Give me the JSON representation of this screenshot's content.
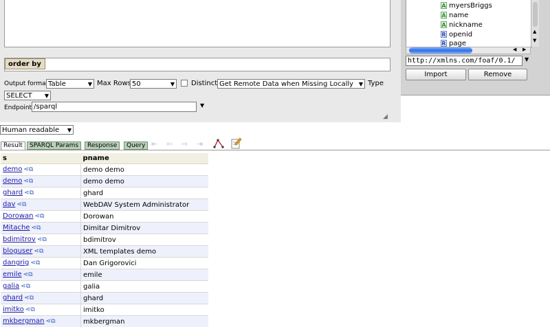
{
  "query_panel": {
    "order_by_label": "order by",
    "output_format_label": "Output format",
    "output_format_value": "Table",
    "max_rows_label": "Max Rows",
    "max_rows_value": "50",
    "distinct_label": "Distinct",
    "distinct_checked": false,
    "remote_data_value": "Get Remote Data when Missing Locally",
    "type_label": "Type",
    "type_value": "SELECT",
    "endpoint_label": "Endpoint",
    "endpoint_value": "/sparql"
  },
  "schema_panel": {
    "tree_items": [
      {
        "icon": "A",
        "label": "myersBriggs"
      },
      {
        "icon": "A",
        "label": "name"
      },
      {
        "icon": "A",
        "label": "nickname"
      },
      {
        "icon": "R",
        "label": "openid"
      },
      {
        "icon": "R",
        "label": "page"
      }
    ],
    "namespace_value": "http://xmlns.com/foaf/0.1/",
    "import_label": "Import",
    "remove_label": "Remove"
  },
  "results": {
    "view_mode": "Human readable",
    "tabs": [
      "Result",
      "SPARQL Params",
      "Response",
      "Query"
    ],
    "active_tab": "Result",
    "columns": [
      "s",
      "pname"
    ],
    "rows": [
      {
        "s": "demo",
        "pname": "demo demo"
      },
      {
        "s": "demo",
        "pname": "demo demo"
      },
      {
        "s": "ghard",
        "pname": "ghard"
      },
      {
        "s": "dav",
        "pname": "WebDAV System Administrator"
      },
      {
        "s": "Dorowan",
        "pname": "Dorowan"
      },
      {
        "s": "Mitache",
        "pname": "Dimitar Dimitrov"
      },
      {
        "s": "bdimitrov",
        "pname": "bdimitrov"
      },
      {
        "s": "bloguser",
        "pname": "XML templates demo"
      },
      {
        "s": "dangrig",
        "pname": "Dan Grigorovici"
      },
      {
        "s": "emile",
        "pname": "emile"
      },
      {
        "s": "galia",
        "pname": "galia"
      },
      {
        "s": "ghard",
        "pname": "ghard"
      },
      {
        "s": "imitko",
        "pname": "imitko"
      },
      {
        "s": "mkbergman",
        "pname": "mkbergman"
      }
    ]
  },
  "colors": {
    "link": "#1a1aaa",
    "row_alt": "#eef0fb",
    "panel_gray": "#d3d3d3",
    "tab_green": "#b9d0b9"
  }
}
